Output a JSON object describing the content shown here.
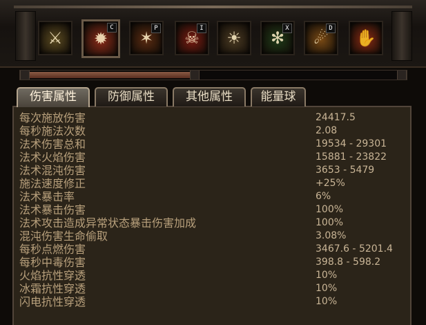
{
  "skills": [
    {
      "icon": "sword-icon",
      "key": "",
      "color": "#5a4a20",
      "active": false
    },
    {
      "icon": "fire-burst-icon",
      "key": "C",
      "color": "#8a2a18",
      "active": true
    },
    {
      "icon": "flame-pillar-icon",
      "key": "P",
      "color": "#5a2a10",
      "active": false
    },
    {
      "icon": "demon-face-icon",
      "key": "I",
      "color": "#7a1a10",
      "active": false
    },
    {
      "icon": "sun-shield-icon",
      "key": "",
      "color": "#4a3a22",
      "active": false
    },
    {
      "icon": "poison-claw-icon",
      "key": "X",
      "color": "#1e3a18",
      "active": false
    },
    {
      "icon": "meteor-icon",
      "key": "D",
      "color": "#7a4a14",
      "active": false
    },
    {
      "icon": "fire-hand-icon",
      "key": "",
      "color": "#8a2a12",
      "active": false
    }
  ],
  "tabs": [
    {
      "label": "伤害属性",
      "active": true
    },
    {
      "label": "防御属性",
      "active": false
    },
    {
      "label": "其他属性",
      "active": false
    },
    {
      "label": "能量球",
      "active": false
    }
  ],
  "progress": {
    "fraction": 0.43
  },
  "stats": [
    {
      "label": "每次施放伤害",
      "value": "24417.5"
    },
    {
      "label": "每秒施法次数",
      "value": "2.08"
    },
    {
      "label": "法术伤害总和",
      "value": "19534 - 29301"
    },
    {
      "label": "法术火焰伤害",
      "value": "15881 - 23822"
    },
    {
      "label": "法术混沌伤害",
      "value": "3653 - 5479"
    },
    {
      "label": "施法速度修正",
      "value": "+25%"
    },
    {
      "label": "法术暴击率",
      "value": "6%"
    },
    {
      "label": "法术暴击伤害",
      "value": "100%"
    },
    {
      "label": "法术攻击造成异常状态暴击伤害加成",
      "value": "100%"
    },
    {
      "label": "混沌伤害生命偷取",
      "value": "3.08%"
    },
    {
      "label": "每秒点燃伤害",
      "value": "3467.6 - 5201.4"
    },
    {
      "label": "每秒中毒伤害",
      "value": "398.8 - 598.2"
    },
    {
      "label": "火焰抗性穿透",
      "value": "10%"
    },
    {
      "label": "冰霜抗性穿透",
      "value": "10%"
    },
    {
      "label": "闪电抗性穿透",
      "value": "10%"
    }
  ]
}
